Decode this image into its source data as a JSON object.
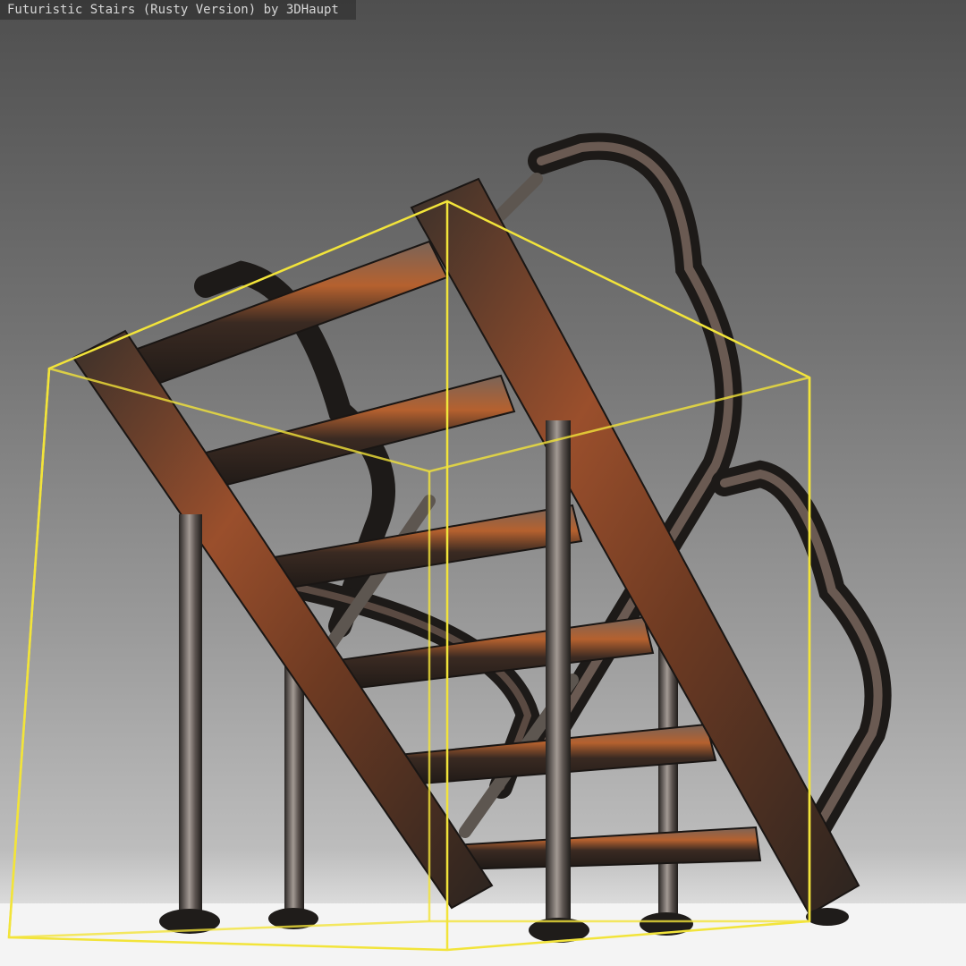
{
  "viewer": {
    "title": "Futuristic Stairs (Rusty Version) by 3DHaupt"
  },
  "colors": {
    "bounding_box": "#f2e43a",
    "rust": "#8a4a2a",
    "metal_dark": "#2a2522",
    "metal_light": "#9a8f88",
    "floor": "#f4f4f4"
  },
  "icons": {
    "model": "staircase-model-icon"
  }
}
